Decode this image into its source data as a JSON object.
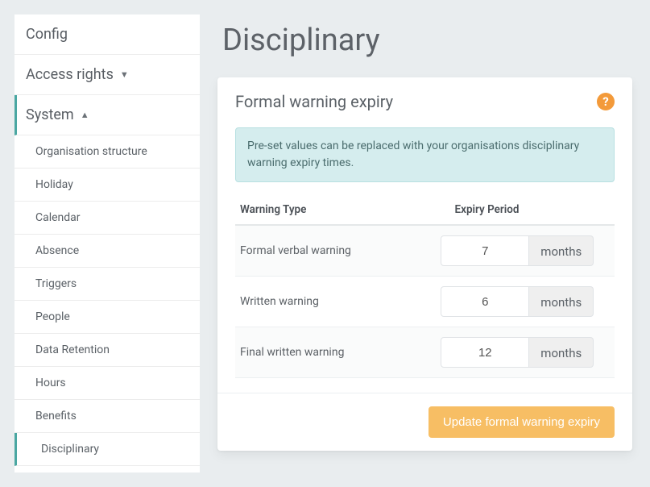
{
  "sidebar": {
    "config_label": "Config",
    "access_label": "Access rights",
    "system_label": "System",
    "items": [
      "Organisation structure",
      "Holiday",
      "Calendar",
      "Absence",
      "Triggers",
      "People",
      "Data Retention",
      "Hours",
      "Benefits",
      "Disciplinary"
    ]
  },
  "page": {
    "title": "Disciplinary",
    "card_title": "Formal warning expiry",
    "help_glyph": "?",
    "info": "Pre-set values can be replaced with your organisations disciplinary warning expiry times.",
    "col_type": "Warning Type",
    "col_period": "Expiry Period",
    "unit": "months",
    "update_btn": "Update formal warning expiry",
    "rows": [
      {
        "type": "Formal verbal warning",
        "value": "7"
      },
      {
        "type": "Written warning",
        "value": "6"
      },
      {
        "type": "Final written warning",
        "value": "12"
      }
    ]
  }
}
